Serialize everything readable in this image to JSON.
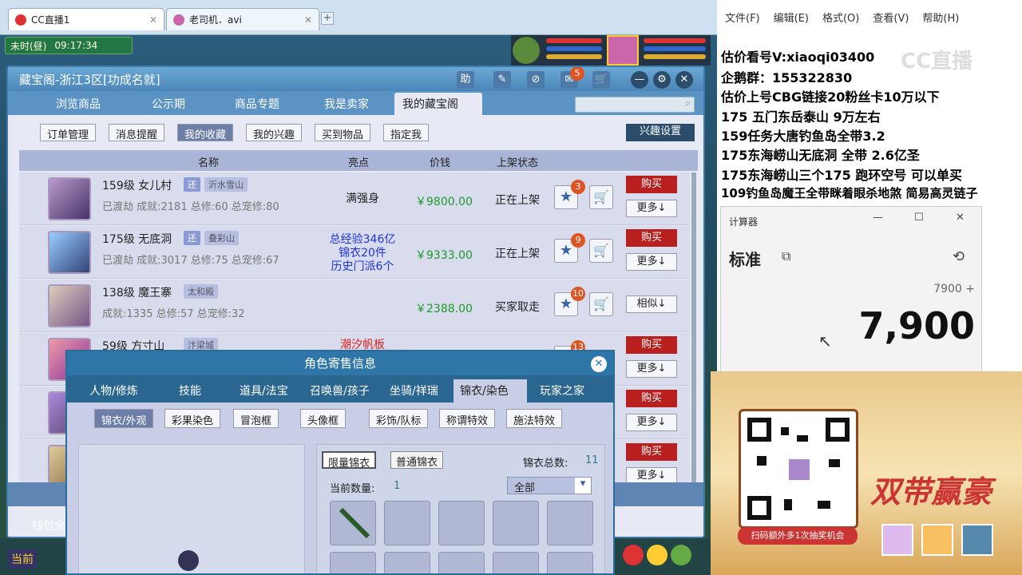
{
  "browser": {
    "tabs": [
      {
        "label": "CC直播1",
        "active": true
      },
      {
        "label": "老司机．avi",
        "active": false
      }
    ],
    "add_tab": "+"
  },
  "game_hud": {
    "time_period": "未时(昼)",
    "clock": "09:17:34",
    "bottom_label": "当前",
    "wallet_label": "钱包余"
  },
  "cbg": {
    "title": "藏宝阁-浙江3区[功成名就]",
    "title_buttons": [
      "助",
      "✎",
      "⊘",
      "✉",
      "🛒"
    ],
    "message_badge": "5",
    "nav_tabs": [
      "浏览商品",
      "公示期",
      "商品专题",
      "我是卖家",
      "我的藏宝阁"
    ],
    "active_nav": 4,
    "sub_tabs": [
      "订单管理",
      "消息提醒",
      "我的收藏",
      "我的兴趣",
      "买到物品",
      "指定我"
    ],
    "active_sub": 2,
    "interest_button": "兴趣设置",
    "columns": [
      "名称",
      "亮点",
      "价钱",
      "上架状态"
    ],
    "rows": [
      {
        "level_name": "159级 女儿村",
        "return_tag": "还",
        "server": "沂水雪山",
        "sub": "已渡劫 成就:2181 总修:60 总宠修:80",
        "highlight": [
          "满强身"
        ],
        "highlight_color": "#222222",
        "price": "￥9800.00",
        "status": "正在上架",
        "fav_count": "3",
        "buy": "购买",
        "more": "更多↓"
      },
      {
        "level_name": "175级 无底洞",
        "return_tag": "还",
        "server": "叠彩山",
        "sub": "已渡劫 成就:3017 总修:75 总宠修:67",
        "highlight": [
          "总经验346亿",
          "锦衣20件",
          "历史门派6个"
        ],
        "highlight_color": "#2233dd",
        "price": "￥9333.00",
        "status": "正在上架",
        "fav_count": "9",
        "buy": "购买",
        "more": "更多↓"
      },
      {
        "level_name": "138级 魔王寨",
        "return_tag": "",
        "server": "太和殿",
        "sub": "成就:1335 总修:57 总宠修:32",
        "highlight": [],
        "highlight_color": "#222222",
        "price": "￥2388.00",
        "status": "买家取走",
        "fav_count": "10",
        "buy": "",
        "more": "相似↓"
      },
      {
        "level_name": "59级 方寸山",
        "return_tag": "",
        "server": "汴梁城",
        "sub": "",
        "highlight": [
          "潮汐帆板"
        ],
        "highlight_color": "#dd2222",
        "price": "",
        "status": "",
        "fav_count": "13",
        "buy": "购买",
        "more": "更多↓"
      },
      {
        "level_name": "",
        "return_tag": "",
        "server": "",
        "sub": "",
        "highlight": [],
        "highlight_color": "#222222",
        "price": "",
        "status": "",
        "fav_count": "",
        "buy": "购买",
        "more": "更多↓"
      },
      {
        "level_name": "",
        "return_tag": "",
        "server": "",
        "sub": "",
        "highlight": [],
        "highlight_color": "#222222",
        "price": "",
        "status": "",
        "fav_count": "",
        "buy": "购买",
        "more": "更多↓"
      }
    ]
  },
  "role_dialog": {
    "title": "角色寄售信息",
    "close": "✕",
    "tabs": [
      "人物/修炼",
      "技能",
      "道具/法宝",
      "召唤兽/孩子",
      "坐骑/祥瑞",
      "锦衣/染色",
      "玩家之家"
    ],
    "active_tab": 5,
    "sub_tabs": [
      "锦衣/外观",
      "彩果染色",
      "冒泡框",
      "头像框",
      "彩饰/队标",
      "称谓特效",
      "施法特效"
    ],
    "active_sub": 0,
    "kind_buttons": [
      "限量锦衣",
      "普通锦衣"
    ],
    "total_label": "锦衣总数:",
    "total_value": "11",
    "count_label": "当前数量:",
    "count_value": "1",
    "filter_value": "全部"
  },
  "notepad": {
    "menu": [
      "文件(F)",
      "编辑(E)",
      "格式(O)",
      "查看(V)",
      "帮助(H)"
    ],
    "lines": [
      "估价看号V:xiaoqi03400",
      "企鹅群：155322830",
      "估价上号CBG链接20粉丝卡10万以下",
      "175 五门东岳泰山  9万左右",
      "159任务大唐钓鱼岛全带3.2",
      "175东海崂山无底洞  全带   2.6亿圣",
      "175东海崂山三个175 跑环空号 可以单买",
      "109钓鱼岛魔王全带眯着眼杀地煞 简易高灵链子"
    ],
    "watermark": "CC直播"
  },
  "calculator": {
    "title": "计算器",
    "mode": "标准",
    "expression": "7900 +",
    "display": "7,900",
    "window_buttons": [
      "—",
      "☐",
      "✕"
    ]
  },
  "promo": {
    "qr_caption": "扫码额外多1次抽奖机会",
    "slogan": "双带赢豪"
  }
}
